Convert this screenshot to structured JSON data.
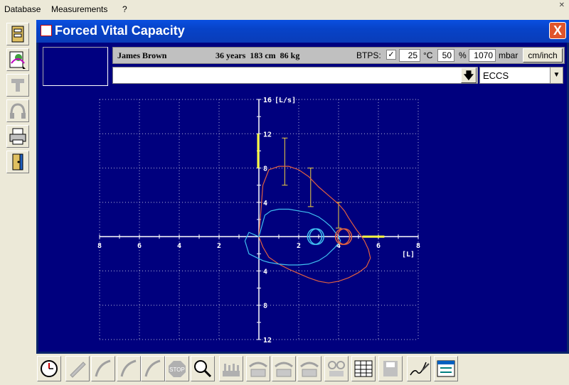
{
  "menu": {
    "items": [
      "Database",
      "Measurements",
      "?"
    ]
  },
  "window": {
    "title": "Forced Vital Capacity",
    "close_label": "X"
  },
  "patient": {
    "name": "James Brown",
    "details": "36 years  183 cm  86 kg"
  },
  "btps": {
    "label": "BTPS:",
    "checked": "✓",
    "temperature": "25",
    "temp_unit": "°C",
    "humidity": "50",
    "humidity_unit": "%",
    "pressure": "1070",
    "pressure_unit": "mbar",
    "units_button": "cm/inch"
  },
  "selectors": {
    "test_value": "",
    "norm_value": "ECCS"
  },
  "chart_data": {
    "type": "line",
    "y_unit_label": "[L/s]",
    "x_unit_label": "[L]",
    "x_ticks": [
      "8",
      "6",
      "4",
      "2",
      "2",
      "4",
      "6",
      "8"
    ],
    "y_ticks_top": [
      "16",
      "12",
      "8",
      "4"
    ],
    "y_ticks_bottom": [
      "4",
      "8",
      "12"
    ],
    "xlim": [
      -8,
      8
    ],
    "ylim": [
      -12,
      16
    ],
    "grid": true,
    "colors": {
      "background": "#00007e",
      "axes": "#ffffff",
      "grid": "#ffffff",
      "curve_orange": "#e06040",
      "curve_cyan": "#40c0f0",
      "predicted": "#f0d040",
      "yellow_axis": "#ffff40"
    },
    "predicted_bars": [
      {
        "x": 1.3,
        "y_low": 6,
        "y_high": 11.5
      },
      {
        "x": 2.6,
        "y_low": 3.5,
        "y_high": 8
      },
      {
        "x": 4.0,
        "y_low": 1,
        "y_high": 4
      }
    ],
    "series": [
      {
        "color": "orange",
        "x": [
          0,
          0.2,
          0.5,
          1.0,
          1.5,
          2.0,
          2.5,
          3.0,
          3.5,
          4.0,
          4.3,
          4.5,
          4.7,
          4.9,
          5.1,
          5.3,
          5.5,
          5.6,
          5.4,
          5.0,
          4.5,
          4.0,
          3.5,
          3.0,
          2.5,
          2.0,
          1.5,
          1.0,
          0.5,
          0.2,
          0
        ],
        "y": [
          0,
          6,
          7.8,
          8.2,
          8.2,
          7.8,
          7.0,
          5.8,
          4.8,
          3.8,
          3.0,
          2.2,
          1.5,
          0.8,
          0.2,
          -0.5,
          -1.5,
          -2.5,
          -3.5,
          -4.2,
          -4.8,
          -5.2,
          -5.4,
          -5.2,
          -4.8,
          -4.3,
          -3.8,
          -3.2,
          -2.4,
          -1.2,
          0
        ]
      },
      {
        "color": "cyan",
        "x": [
          0,
          0.3,
          0.6,
          1.0,
          1.5,
          2.0,
          2.5,
          3.0,
          3.3,
          3.6,
          3.8,
          4.0,
          4.1,
          3.8,
          3.4,
          3.0,
          2.5,
          2.0,
          1.5,
          1.0,
          0.5,
          0.2,
          -0.5,
          -0.7,
          -0.5,
          0
        ],
        "y": [
          0,
          2.5,
          3.0,
          3.2,
          3.2,
          3.0,
          2.8,
          2.3,
          1.8,
          1.2,
          0.6,
          0,
          -0.5,
          -1.3,
          -2.2,
          -2.8,
          -3.2,
          -3.3,
          -3.3,
          -3.2,
          -3.0,
          -2.8,
          -2.0,
          -0.5,
          0.5,
          0
        ]
      }
    ]
  },
  "toolbar": {
    "left": [
      "database-icon",
      "patient-icon",
      "calibration-icon",
      "headphones-icon",
      "printer-icon",
      "exit-icon"
    ],
    "bottom": [
      "timer-icon",
      "pencil-icon",
      "curve-icon",
      "curve-icon",
      "curve-icon",
      "stop-icon",
      "magnifier-icon",
      "bars-icon",
      "table-icon",
      "table-icon",
      "table-icon",
      "glasses-icon",
      "grid-icon",
      "disk-icon",
      "signature-icon",
      "report-icon"
    ]
  }
}
